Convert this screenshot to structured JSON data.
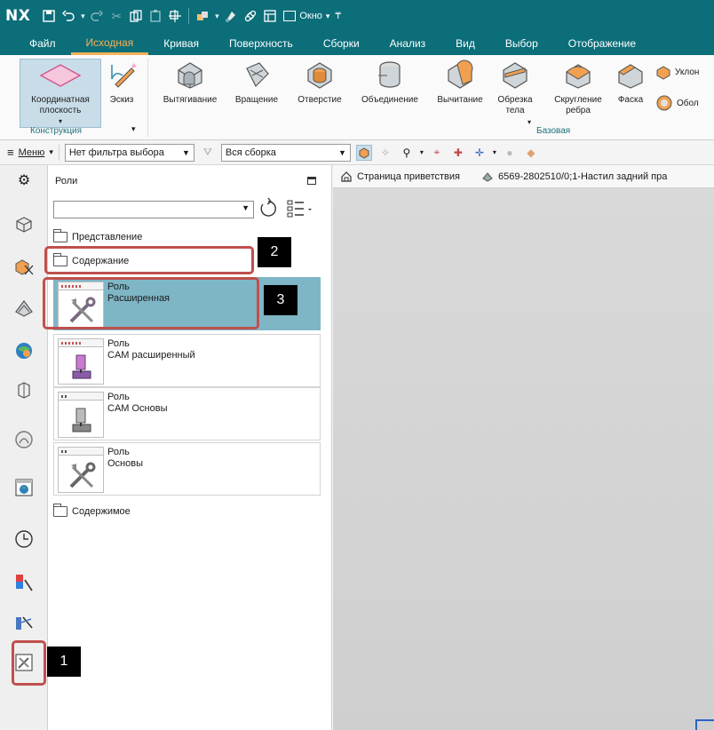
{
  "app": {
    "logo": "NX",
    "window_menu": "Окно"
  },
  "ribbon_tabs": [
    "Файл",
    "Исходная",
    "Кривая",
    "Поверхность",
    "Сборки",
    "Анализ",
    "Вид",
    "Выбор",
    "Отображение"
  ],
  "active_tab": "Исходная",
  "ribbon": {
    "datum_plane": "Координатная плоскость",
    "sketch": "Эскиз",
    "extrude": "Вытягивание",
    "revolve": "Вращение",
    "hole": "Отверстие",
    "unite": "Объединение",
    "subtract": "Вычитание",
    "trim_body": "Обрезка тела",
    "edge_blend": "Скругление ребра",
    "chamfer": "Фаска",
    "draft": "Уклон",
    "shell": "Обол",
    "group_construction": "Конструкция",
    "group_base": "Базовая"
  },
  "toolbar": {
    "menu": "Меню",
    "selection_filter": "Нет фильтра выбора",
    "assembly_scope": "Вся сборка"
  },
  "panel": {
    "title": "Роли",
    "folder_representation": "Представление",
    "folder_content": "Содержание",
    "folder_contents": "Содержимое"
  },
  "roles": [
    {
      "line1": "Роль",
      "line2": "Расширенная",
      "selected": true
    },
    {
      "line1": "Роль",
      "line2": "CAM расширенный",
      "selected": false
    },
    {
      "line1": "Роль",
      "line2": "CAM Основы",
      "selected": false
    },
    {
      "line1": "Роль",
      "line2": "Основы",
      "selected": false
    }
  ],
  "viewport_tabs": {
    "welcome": "Страница приветствия",
    "part": "6569-2802510/0;1-Настил задний пра"
  },
  "annotations": {
    "marker_1": "1",
    "marker_2": "2",
    "marker_3": "3"
  },
  "colors": {
    "titlebar": "#0b6e79",
    "active_tab": "#f6b15a",
    "selected_role": "#7fb6c6",
    "annotation": "#c0504d"
  }
}
